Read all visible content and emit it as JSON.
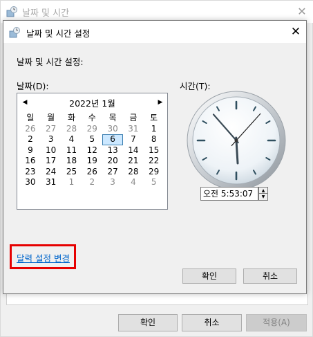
{
  "parent": {
    "title": "날짜 및 시간",
    "buttons": {
      "ok": "확인",
      "cancel": "취소",
      "apply": "적용(A)"
    }
  },
  "dialog": {
    "title": "날짜 및 시간 설정",
    "heading": "날짜 및 시간 설정:",
    "date_label": "날짜(D):",
    "time_label": "시간(T):",
    "calendar": {
      "month_label": "2022년 1월",
      "weekdays": [
        "일",
        "월",
        "화",
        "수",
        "목",
        "금",
        "토"
      ],
      "weeks": [
        [
          "26",
          "27",
          "28",
          "29",
          "30",
          "31",
          "1"
        ],
        [
          "2",
          "3",
          "4",
          "5",
          "6",
          "7",
          "8"
        ],
        [
          "9",
          "10",
          "11",
          "12",
          "13",
          "14",
          "15"
        ],
        [
          "16",
          "17",
          "18",
          "19",
          "20",
          "21",
          "22"
        ],
        [
          "23",
          "24",
          "25",
          "26",
          "27",
          "28",
          "29"
        ],
        [
          "30",
          "31",
          "1",
          "2",
          "3",
          "4",
          "5"
        ]
      ],
      "selected": "6"
    },
    "time_value": "오전   5:53:07",
    "clock": {
      "hour": 5,
      "minute": 53,
      "second": 7
    },
    "link": "달력 설정 변경",
    "buttons": {
      "ok": "확인",
      "cancel": "취소"
    }
  },
  "colors": {
    "link": "#0066cc",
    "highlight": "#e60000",
    "selected_bg": "#cce8ff"
  },
  "icons": {
    "title": "clock-globe-icon",
    "close": "close-icon",
    "prev": "triangle-left-icon",
    "next": "triangle-right-icon"
  }
}
